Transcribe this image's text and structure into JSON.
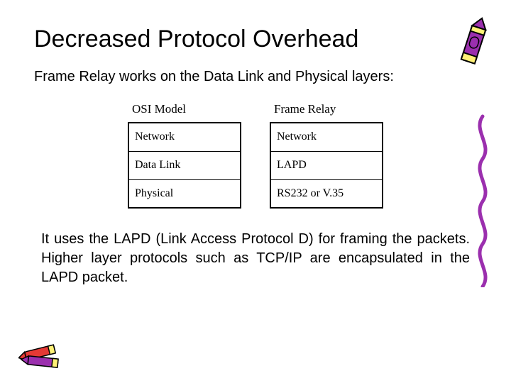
{
  "title": "Decreased Protocol Overhead",
  "intro": "Frame Relay works on the Data Link and Physical layers:",
  "table": {
    "left_header": "OSI Model",
    "right_header": "Frame Relay",
    "left_rows": [
      "Network",
      "Data Link",
      "Physical"
    ],
    "right_rows": [
      "Network",
      "LAPD",
      "RS232 or V.35"
    ]
  },
  "description": "It uses the LAPD (Link Access Protocol D) for framing the packets. Higher layer protocols such as TCP/IP are encapsulated in the LAPD packet."
}
